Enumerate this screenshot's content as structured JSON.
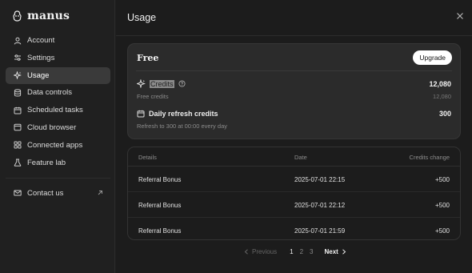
{
  "app": {
    "brand": "manus"
  },
  "sidebar": {
    "items": [
      {
        "label": "Account",
        "icon": "user-icon"
      },
      {
        "label": "Settings",
        "icon": "sliders-icon"
      },
      {
        "label": "Usage",
        "icon": "sparkle-icon",
        "active": true
      },
      {
        "label": "Data controls",
        "icon": "database-icon"
      },
      {
        "label": "Scheduled tasks",
        "icon": "calendar-icon"
      },
      {
        "label": "Cloud browser",
        "icon": "browser-icon"
      },
      {
        "label": "Connected apps",
        "icon": "apps-grid-icon"
      },
      {
        "label": "Feature lab",
        "icon": "flask-icon"
      }
    ],
    "contact": {
      "label": "Contact us",
      "icon": "mail-icon"
    }
  },
  "header": {
    "title": "Usage"
  },
  "plan": {
    "name": "Free",
    "upgrade_label": "Upgrade",
    "credits": {
      "label": "Credits",
      "value": "12,080",
      "sub_label": "Free credits",
      "sub_value": "12,080"
    },
    "refresh": {
      "label": "Daily refresh credits",
      "value": "300",
      "sub_label": "Refresh to 300 at 00:00 every day"
    }
  },
  "table": {
    "headers": {
      "details": "Details",
      "date": "Date",
      "change": "Credits change"
    },
    "rows": [
      {
        "details": "Referral Bonus",
        "date": "2025-07-01 22:15",
        "change": "+500"
      },
      {
        "details": "Referral Bonus",
        "date": "2025-07-01 22:12",
        "change": "+500"
      },
      {
        "details": "Referral Bonus",
        "date": "2025-07-01 21:59",
        "change": "+500"
      }
    ]
  },
  "pagination": {
    "previous": "Previous",
    "next": "Next",
    "pages": [
      "1",
      "2",
      "3"
    ],
    "current": "1"
  }
}
